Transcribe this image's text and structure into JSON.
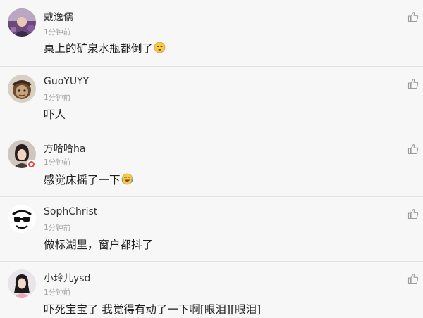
{
  "comments": [
    {
      "name": "戴逸儒",
      "time": "1分钟前",
      "text": "桌上的矿泉水瓶都倒了",
      "emoji": "sleepy-face-emoji",
      "avatar": "avatar-purple-photo"
    },
    {
      "name": "GuoYUYY",
      "time": "1分钟前",
      "text": "吓人",
      "avatar": "avatar-cartoon-character"
    },
    {
      "name": "方哈哈ha",
      "time": "1分钟前",
      "text": "感觉床摇了一下",
      "emoji": "crying-laughing-emoji",
      "avatar": "avatar-girl-photo",
      "verified": true
    },
    {
      "name": "SophChrist",
      "time": "1分钟前",
      "text": "做标湖里，窗户都抖了",
      "avatar": "avatar-sketch-face"
    },
    {
      "name": "小玲儿ysd",
      "time": "1分钟前",
      "text": "吓死宝宝了 我觉得有动了一下啊[眼泪][眼泪]",
      "avatar": "avatar-woman-photo"
    }
  ],
  "icons": {
    "like": "thumbs-up-icon"
  },
  "colors": {
    "background": "#f7f7f7",
    "divider": "#e2e2e2",
    "timestamp": "#a5a5a5",
    "badge": "#e8443a"
  }
}
